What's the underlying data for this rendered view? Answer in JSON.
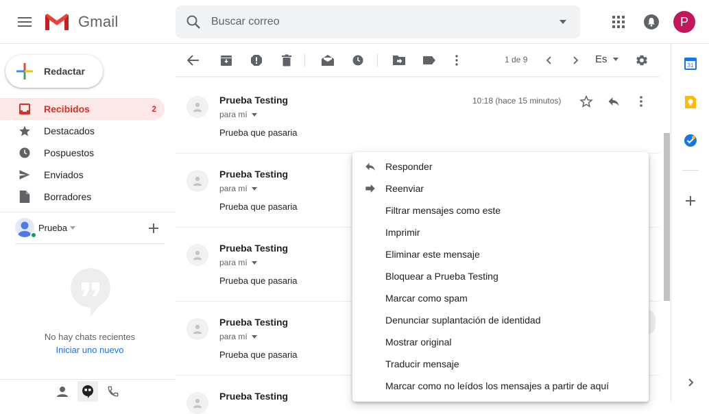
{
  "header": {
    "logo_text": "Gmail",
    "search_placeholder": "Buscar correo",
    "avatar_letter": "P"
  },
  "compose": {
    "label": "Redactar"
  },
  "nav": {
    "items": [
      {
        "label": "Recibidos",
        "count": "2",
        "icon": "inbox-icon",
        "active": true
      },
      {
        "label": "Destacados",
        "icon": "star-icon"
      },
      {
        "label": "Pospuestos",
        "icon": "clock-icon"
      },
      {
        "label": "Enviados",
        "icon": "send-icon"
      },
      {
        "label": "Borradores",
        "icon": "draft-icon"
      }
    ]
  },
  "hangouts": {
    "user_name": "Prueba",
    "no_chats": "No hay chats recientes",
    "start_new": "Iniciar uno nuevo"
  },
  "toolbar": {
    "pager": "1 de 9",
    "lang": "Es"
  },
  "thread": {
    "messages": [
      {
        "sender": "Prueba Testing",
        "to": "para mí",
        "body": "Prueba que pasaria",
        "time": "10:18 (hace 15 minutos)"
      },
      {
        "sender": "Prueba Testing",
        "to": "para mí",
        "body": "Prueba que pasaria"
      },
      {
        "sender": "Prueba Testing",
        "to": "para mí",
        "body": "Prueba que pasaria"
      },
      {
        "sender": "Prueba Testing",
        "to": "para mí",
        "body": "Prueba que pasaria"
      },
      {
        "sender": "Prueba Testing"
      }
    ]
  },
  "context_menu": {
    "items": [
      {
        "label": "Responder",
        "icon": "reply-icon"
      },
      {
        "label": "Reenviar",
        "icon": "forward-icon"
      },
      {
        "label": "Filtrar mensajes como este"
      },
      {
        "label": "Imprimir"
      },
      {
        "label": "Eliminar este mensaje"
      },
      {
        "label": "Bloquear a Prueba Testing"
      },
      {
        "label": "Marcar como spam"
      },
      {
        "label": "Denunciar suplantación de identidad"
      },
      {
        "label": "Mostrar original"
      },
      {
        "label": "Traducir mensaje"
      },
      {
        "label": "Marcar como no leídos los mensajes a partir de aquí"
      }
    ]
  },
  "side_panel": {
    "calendar_day": "31"
  },
  "colors": {
    "accent_red": "#d93025",
    "avatar_bg": "#c2185b",
    "link_blue": "#1a73e8"
  }
}
